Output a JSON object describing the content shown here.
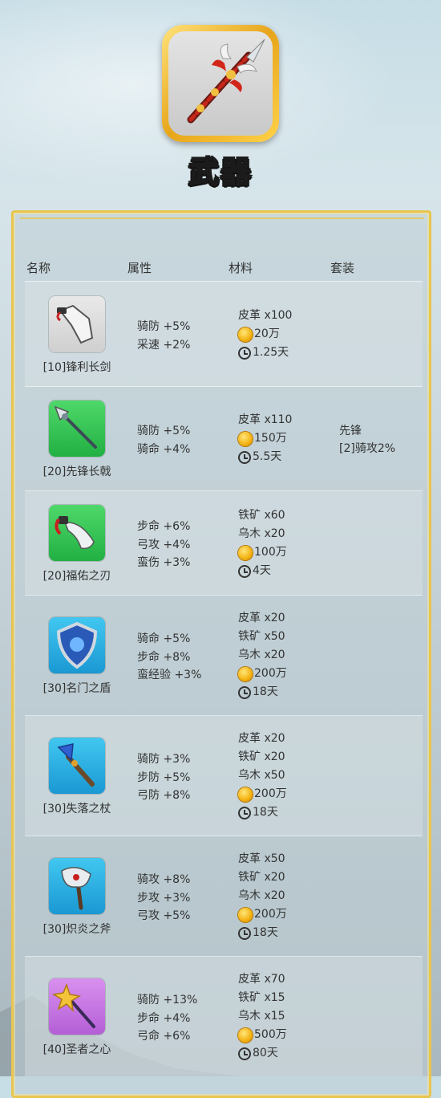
{
  "header": {
    "title": "武器",
    "icon": "spear-icon"
  },
  "table": {
    "columns": [
      "名称",
      "属性",
      "材料",
      "套装"
    ],
    "rows": [
      {
        "name": "[10]锋利长剑",
        "icon": "cleaver-icon",
        "rarity_color": "gray",
        "attrs": [
          "骑防 +5%",
          "采速 +2%"
        ],
        "materials": [
          "皮革 x100"
        ],
        "gold": "20万",
        "time": "1.25天",
        "suit": []
      },
      {
        "name": "[20]先锋长戟",
        "icon": "halberd-icon",
        "rarity_color": "green",
        "attrs": [
          "骑防 +5%",
          "骑命 +4%"
        ],
        "materials": [
          "皮革 x110"
        ],
        "gold": "150万",
        "time": "5.5天",
        "suit": [
          "先锋",
          "[2]骑攻2%"
        ]
      },
      {
        "name": "[20]福佑之刃",
        "icon": "blade-icon",
        "rarity_color": "green",
        "attrs": [
          "步命 +6%",
          "弓攻 +4%",
          "蛮伤 +3%"
        ],
        "materials": [
          "铁矿 x60",
          "乌木 x20"
        ],
        "gold": "100万",
        "time": "4天",
        "suit": []
      },
      {
        "name": "[30]名门之盾",
        "icon": "shield-icon",
        "rarity_color": "blue",
        "attrs": [
          "骑命 +5%",
          "步命 +8%",
          "蛮经验 +3%"
        ],
        "materials": [
          "皮革 x20",
          "铁矿 x50",
          "乌木 x20"
        ],
        "gold": "200万",
        "time": "18天",
        "suit": []
      },
      {
        "name": "[30]失落之杖",
        "icon": "staff-icon",
        "rarity_color": "blue",
        "attrs": [
          "骑防 +3%",
          "步防 +5%",
          "弓防 +8%"
        ],
        "materials": [
          "皮革 x20",
          "铁矿 x20",
          "乌木 x50"
        ],
        "gold": "200万",
        "time": "18天",
        "suit": []
      },
      {
        "name": "[30]炽炎之斧",
        "icon": "axe-icon",
        "rarity_color": "blue",
        "attrs": [
          "骑攻 +8%",
          "步攻 +3%",
          "弓攻 +5%"
        ],
        "materials": [
          "皮革 x50",
          "铁矿 x20",
          "乌木 x20"
        ],
        "gold": "200万",
        "time": "18天",
        "suit": []
      },
      {
        "name": "[40]圣者之心",
        "icon": "scepter-icon",
        "rarity_color": "purple",
        "attrs": [
          "骑防 +13%",
          "步命 +4%",
          "弓命 +6%"
        ],
        "materials": [
          "皮革 x70",
          "铁矿 x15",
          "乌木 x15"
        ],
        "gold": "500万",
        "time": "80天",
        "suit": []
      }
    ]
  }
}
